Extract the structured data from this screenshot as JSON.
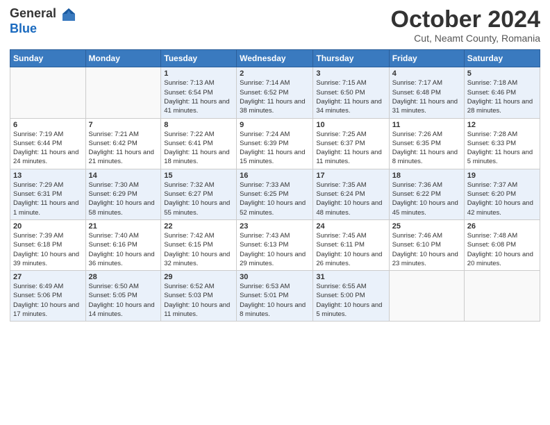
{
  "header": {
    "logo_general": "General",
    "logo_blue": "Blue",
    "title": "October 2024",
    "location": "Cut, Neamt County, Romania"
  },
  "weekdays": [
    "Sunday",
    "Monday",
    "Tuesday",
    "Wednesday",
    "Thursday",
    "Friday",
    "Saturday"
  ],
  "weeks": [
    [
      {
        "day": "",
        "sunrise": "",
        "sunset": "",
        "daylight": ""
      },
      {
        "day": "",
        "sunrise": "",
        "sunset": "",
        "daylight": ""
      },
      {
        "day": "1",
        "sunrise": "Sunrise: 7:13 AM",
        "sunset": "Sunset: 6:54 PM",
        "daylight": "Daylight: 11 hours and 41 minutes."
      },
      {
        "day": "2",
        "sunrise": "Sunrise: 7:14 AM",
        "sunset": "Sunset: 6:52 PM",
        "daylight": "Daylight: 11 hours and 38 minutes."
      },
      {
        "day": "3",
        "sunrise": "Sunrise: 7:15 AM",
        "sunset": "Sunset: 6:50 PM",
        "daylight": "Daylight: 11 hours and 34 minutes."
      },
      {
        "day": "4",
        "sunrise": "Sunrise: 7:17 AM",
        "sunset": "Sunset: 6:48 PM",
        "daylight": "Daylight: 11 hours and 31 minutes."
      },
      {
        "day": "5",
        "sunrise": "Sunrise: 7:18 AM",
        "sunset": "Sunset: 6:46 PM",
        "daylight": "Daylight: 11 hours and 28 minutes."
      }
    ],
    [
      {
        "day": "6",
        "sunrise": "Sunrise: 7:19 AM",
        "sunset": "Sunset: 6:44 PM",
        "daylight": "Daylight: 11 hours and 24 minutes."
      },
      {
        "day": "7",
        "sunrise": "Sunrise: 7:21 AM",
        "sunset": "Sunset: 6:42 PM",
        "daylight": "Daylight: 11 hours and 21 minutes."
      },
      {
        "day": "8",
        "sunrise": "Sunrise: 7:22 AM",
        "sunset": "Sunset: 6:41 PM",
        "daylight": "Daylight: 11 hours and 18 minutes."
      },
      {
        "day": "9",
        "sunrise": "Sunrise: 7:24 AM",
        "sunset": "Sunset: 6:39 PM",
        "daylight": "Daylight: 11 hours and 15 minutes."
      },
      {
        "day": "10",
        "sunrise": "Sunrise: 7:25 AM",
        "sunset": "Sunset: 6:37 PM",
        "daylight": "Daylight: 11 hours and 11 minutes."
      },
      {
        "day": "11",
        "sunrise": "Sunrise: 7:26 AM",
        "sunset": "Sunset: 6:35 PM",
        "daylight": "Daylight: 11 hours and 8 minutes."
      },
      {
        "day": "12",
        "sunrise": "Sunrise: 7:28 AM",
        "sunset": "Sunset: 6:33 PM",
        "daylight": "Daylight: 11 hours and 5 minutes."
      }
    ],
    [
      {
        "day": "13",
        "sunrise": "Sunrise: 7:29 AM",
        "sunset": "Sunset: 6:31 PM",
        "daylight": "Daylight: 11 hours and 1 minute."
      },
      {
        "day": "14",
        "sunrise": "Sunrise: 7:30 AM",
        "sunset": "Sunset: 6:29 PM",
        "daylight": "Daylight: 10 hours and 58 minutes."
      },
      {
        "day": "15",
        "sunrise": "Sunrise: 7:32 AM",
        "sunset": "Sunset: 6:27 PM",
        "daylight": "Daylight: 10 hours and 55 minutes."
      },
      {
        "day": "16",
        "sunrise": "Sunrise: 7:33 AM",
        "sunset": "Sunset: 6:25 PM",
        "daylight": "Daylight: 10 hours and 52 minutes."
      },
      {
        "day": "17",
        "sunrise": "Sunrise: 7:35 AM",
        "sunset": "Sunset: 6:24 PM",
        "daylight": "Daylight: 10 hours and 48 minutes."
      },
      {
        "day": "18",
        "sunrise": "Sunrise: 7:36 AM",
        "sunset": "Sunset: 6:22 PM",
        "daylight": "Daylight: 10 hours and 45 minutes."
      },
      {
        "day": "19",
        "sunrise": "Sunrise: 7:37 AM",
        "sunset": "Sunset: 6:20 PM",
        "daylight": "Daylight: 10 hours and 42 minutes."
      }
    ],
    [
      {
        "day": "20",
        "sunrise": "Sunrise: 7:39 AM",
        "sunset": "Sunset: 6:18 PM",
        "daylight": "Daylight: 10 hours and 39 minutes."
      },
      {
        "day": "21",
        "sunrise": "Sunrise: 7:40 AM",
        "sunset": "Sunset: 6:16 PM",
        "daylight": "Daylight: 10 hours and 36 minutes."
      },
      {
        "day": "22",
        "sunrise": "Sunrise: 7:42 AM",
        "sunset": "Sunset: 6:15 PM",
        "daylight": "Daylight: 10 hours and 32 minutes."
      },
      {
        "day": "23",
        "sunrise": "Sunrise: 7:43 AM",
        "sunset": "Sunset: 6:13 PM",
        "daylight": "Daylight: 10 hours and 29 minutes."
      },
      {
        "day": "24",
        "sunrise": "Sunrise: 7:45 AM",
        "sunset": "Sunset: 6:11 PM",
        "daylight": "Daylight: 10 hours and 26 minutes."
      },
      {
        "day": "25",
        "sunrise": "Sunrise: 7:46 AM",
        "sunset": "Sunset: 6:10 PM",
        "daylight": "Daylight: 10 hours and 23 minutes."
      },
      {
        "day": "26",
        "sunrise": "Sunrise: 7:48 AM",
        "sunset": "Sunset: 6:08 PM",
        "daylight": "Daylight: 10 hours and 20 minutes."
      }
    ],
    [
      {
        "day": "27",
        "sunrise": "Sunrise: 6:49 AM",
        "sunset": "Sunset: 5:06 PM",
        "daylight": "Daylight: 10 hours and 17 minutes."
      },
      {
        "day": "28",
        "sunrise": "Sunrise: 6:50 AM",
        "sunset": "Sunset: 5:05 PM",
        "daylight": "Daylight: 10 hours and 14 minutes."
      },
      {
        "day": "29",
        "sunrise": "Sunrise: 6:52 AM",
        "sunset": "Sunset: 5:03 PM",
        "daylight": "Daylight: 10 hours and 11 minutes."
      },
      {
        "day": "30",
        "sunrise": "Sunrise: 6:53 AM",
        "sunset": "Sunset: 5:01 PM",
        "daylight": "Daylight: 10 hours and 8 minutes."
      },
      {
        "day": "31",
        "sunrise": "Sunrise: 6:55 AM",
        "sunset": "Sunset: 5:00 PM",
        "daylight": "Daylight: 10 hours and 5 minutes."
      },
      {
        "day": "",
        "sunrise": "",
        "sunset": "",
        "daylight": ""
      },
      {
        "day": "",
        "sunrise": "",
        "sunset": "",
        "daylight": ""
      }
    ]
  ]
}
